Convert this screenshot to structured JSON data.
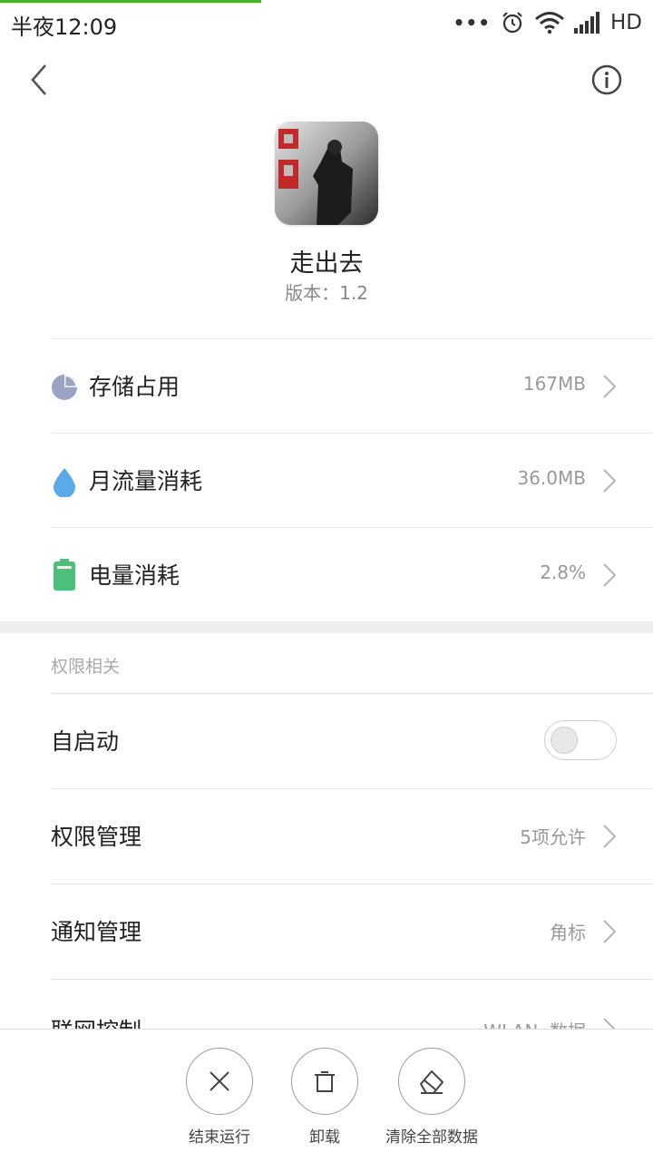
{
  "status_bar": {
    "time": "半夜12:09",
    "dots": "•••",
    "network": "HD"
  },
  "app": {
    "name": "走出去",
    "version": "版本：1.2"
  },
  "usage_rows": [
    {
      "label": "存储占用",
      "value": "167MB",
      "icon": "pie-chart-icon",
      "color": "#9aa3c2"
    },
    {
      "label": "月流量消耗",
      "value": "36.0MB",
      "icon": "water-drop-icon",
      "color": "#5aa9e8"
    },
    {
      "label": "电量消耗",
      "value": "2.8%",
      "icon": "battery-icon",
      "color": "#4cc07a"
    }
  ],
  "permissions": {
    "section_title": "权限相关",
    "autostart": {
      "label": "自启动",
      "enabled": false
    },
    "permission_manage": {
      "label": "权限管理",
      "value": "5项允许"
    },
    "notification_manage": {
      "label": "通知管理",
      "value": "角标"
    },
    "network_control": {
      "label": "联网控制",
      "value": "WLAN, 数据"
    }
  },
  "actions": [
    {
      "label": "结束运行",
      "icon": "close-icon"
    },
    {
      "label": "卸载",
      "icon": "trash-icon"
    },
    {
      "label": "清除全部数据",
      "icon": "eraser-icon"
    }
  ],
  "colors": {
    "accent_progress": "#4caf2a",
    "toggle_off": "#e8e8e8"
  }
}
